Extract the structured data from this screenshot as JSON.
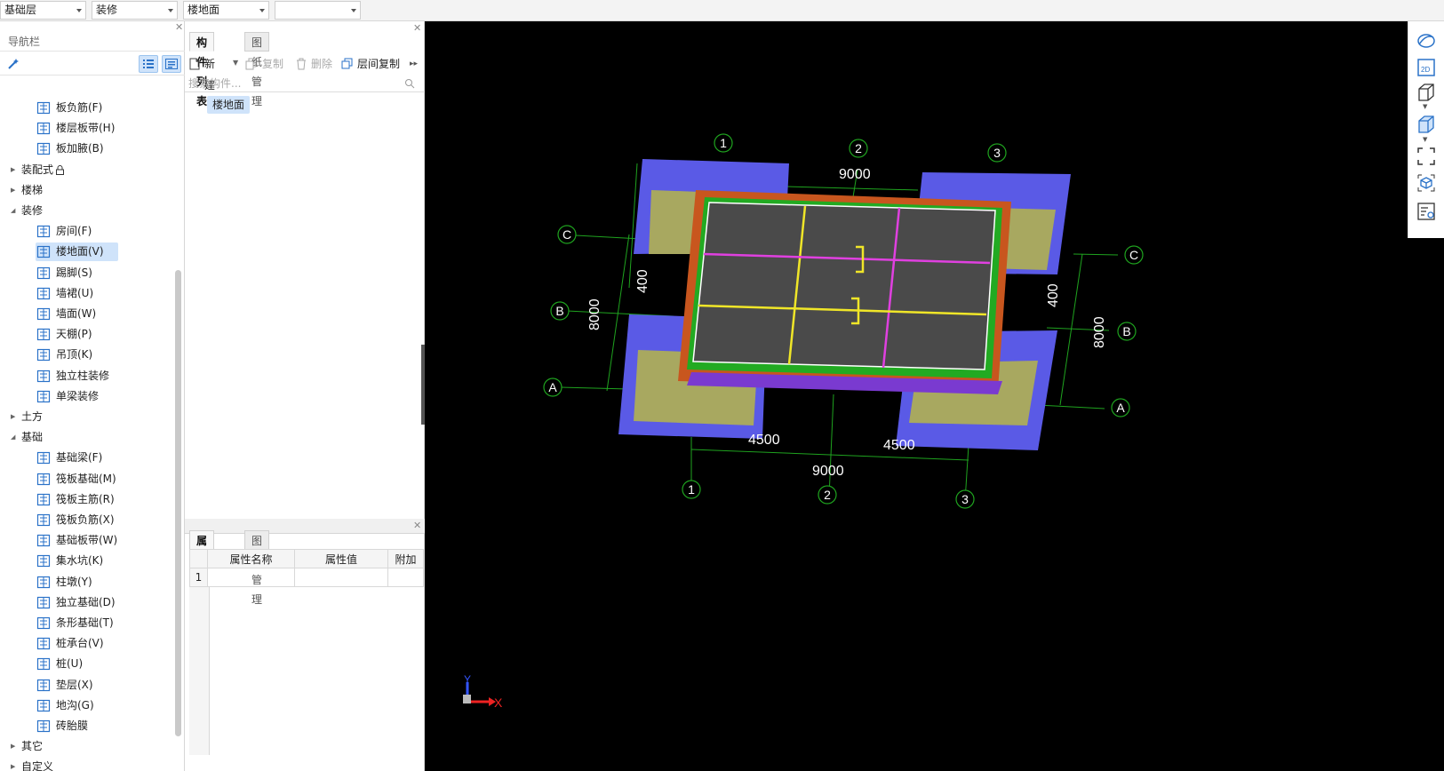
{
  "toolbar": {
    "floor_select": "基础层",
    "category_select": "装修",
    "type_select": "楼地面",
    "extra_select": ""
  },
  "nav": {
    "title": "导航栏",
    "tree": [
      {
        "label": "板负筋(F)",
        "level": 2,
        "icon": "slab-neg-rebar-icon"
      },
      {
        "label": "楼层板带(H)",
        "level": 2,
        "icon": "slab-strip-icon"
      },
      {
        "label": "板加腋(B)",
        "level": 2,
        "icon": "slab-haunch-icon"
      },
      {
        "label": "装配式",
        "level": 1,
        "expanded": false,
        "locked": true
      },
      {
        "label": "楼梯",
        "level": 1,
        "expanded": false
      },
      {
        "label": "装修",
        "level": 1,
        "expanded": true
      },
      {
        "label": "房间(F)",
        "level": 2,
        "icon": "room-icon"
      },
      {
        "label": "楼地面(V)",
        "level": 2,
        "icon": "floor-surface-icon",
        "selected": true
      },
      {
        "label": "踢脚(S)",
        "level": 2,
        "icon": "skirting-icon"
      },
      {
        "label": "墙裙(U)",
        "level": 2,
        "icon": "dado-icon"
      },
      {
        "label": "墙面(W)",
        "level": 2,
        "icon": "wall-surface-icon"
      },
      {
        "label": "天棚(P)",
        "level": 2,
        "icon": "ceiling-icon"
      },
      {
        "label": "吊顶(K)",
        "level": 2,
        "icon": "suspended-ceiling-icon"
      },
      {
        "label": "独立柱装修",
        "level": 2,
        "icon": "column-finish-icon"
      },
      {
        "label": "单梁装修",
        "level": 2,
        "icon": "beam-finish-icon"
      },
      {
        "label": "土方",
        "level": 1,
        "expanded": false
      },
      {
        "label": "基础",
        "level": 1,
        "expanded": true
      },
      {
        "label": "基础梁(F)",
        "level": 2,
        "icon": "foundation-beam-icon"
      },
      {
        "label": "筏板基础(M)",
        "level": 2,
        "icon": "raft-foundation-icon"
      },
      {
        "label": "筏板主筋(R)",
        "level": 2,
        "icon": "raft-main-rebar-icon"
      },
      {
        "label": "筏板负筋(X)",
        "level": 2,
        "icon": "raft-neg-rebar-icon"
      },
      {
        "label": "基础板带(W)",
        "level": 2,
        "icon": "foundation-strip-icon"
      },
      {
        "label": "集水坑(K)",
        "level": 2,
        "icon": "sump-pit-icon"
      },
      {
        "label": "柱墩(Y)",
        "level": 2,
        "icon": "column-pier-icon"
      },
      {
        "label": "独立基础(D)",
        "level": 2,
        "icon": "isolated-footing-icon"
      },
      {
        "label": "条形基础(T)",
        "level": 2,
        "icon": "strip-footing-icon"
      },
      {
        "label": "桩承台(V)",
        "level": 2,
        "icon": "pile-cap-icon"
      },
      {
        "label": "桩(U)",
        "level": 2,
        "icon": "pile-icon"
      },
      {
        "label": "垫层(X)",
        "level": 2,
        "icon": "cushion-layer-icon"
      },
      {
        "label": "地沟(G)",
        "level": 2,
        "icon": "trench-icon"
      },
      {
        "label": "砖胎膜",
        "level": 2,
        "icon": "brick-mold-icon"
      },
      {
        "label": "其它",
        "level": 1,
        "expanded": false
      },
      {
        "label": "自定义",
        "level": 1,
        "expanded": false
      }
    ]
  },
  "components": {
    "tabs": [
      "构件列表",
      "图纸管理"
    ],
    "active_tab": 0,
    "tools": {
      "new": "新建",
      "copy": "复制",
      "delete": "删除",
      "floor_copy": "层间复制"
    },
    "search_placeholder": "搜索构件...",
    "items": [
      "楼地面"
    ]
  },
  "properties": {
    "tabs": [
      "属性列表",
      "图层管理"
    ],
    "active_tab": 0,
    "columns": [
      "属性名称",
      "属性值",
      "附加"
    ],
    "rows": [
      {
        "index": "1",
        "name": "",
        "value": "",
        "extra": ""
      }
    ]
  },
  "viewport": {
    "axis_labels": {
      "top": [
        "1",
        "2",
        "3"
      ],
      "bottom": [
        "1",
        "2",
        "3"
      ],
      "left": [
        "C",
        "B",
        "A"
      ],
      "right": [
        "C",
        "B",
        "A"
      ]
    },
    "dimensions": {
      "top_total": "9000",
      "bottom_total": "9000",
      "bottom_left": "4500",
      "bottom_right": "4500",
      "left_total": "8000",
      "right_total": "8000",
      "left_span": "400",
      "right_span": "400"
    },
    "axis_indicator": {
      "x": "X",
      "y": "Y"
    },
    "colors": {
      "background": "#000000",
      "grid": "#1fa31f",
      "footing": "#5a5ae6",
      "slab": "#4a4a4a",
      "beam": "#c8561e",
      "rebar_yellow": "#f0e628",
      "rebar_magenta": "#e040e0"
    }
  }
}
